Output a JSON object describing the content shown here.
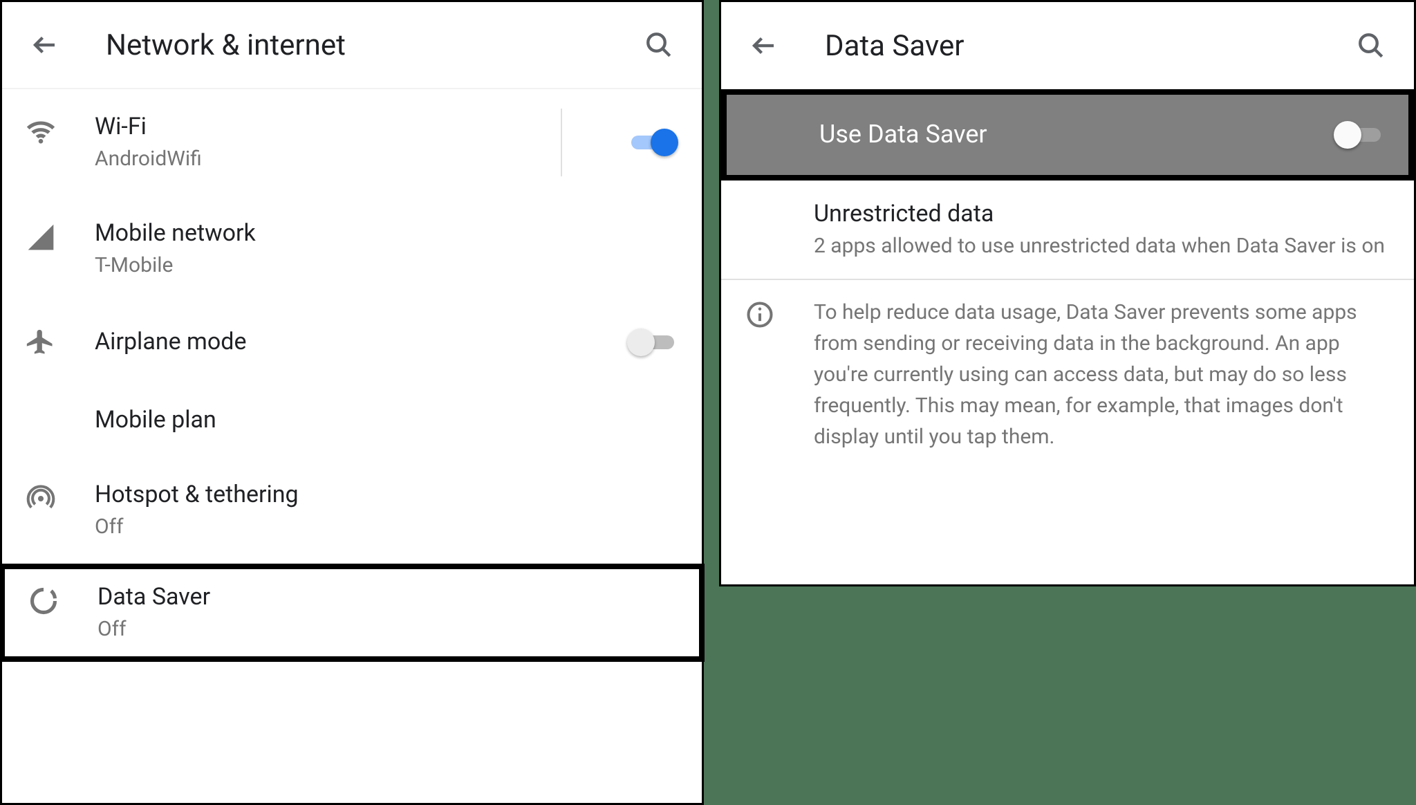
{
  "left": {
    "title": "Network & internet",
    "items": [
      {
        "title": "Wi-Fi",
        "sub": "AndroidWifi",
        "toggle": "on"
      },
      {
        "title": "Mobile network",
        "sub": "T-Mobile"
      },
      {
        "title": "Airplane mode",
        "sub": null,
        "toggle": "off"
      },
      {
        "title": "Mobile plan",
        "sub": null
      },
      {
        "title": "Hotspot & tethering",
        "sub": "Off"
      },
      {
        "title": "Data Saver",
        "sub": "Off"
      }
    ]
  },
  "right": {
    "title": "Data Saver",
    "use_row_title": "Use Data Saver",
    "unrestricted_title": "Unrestricted data",
    "unrestricted_sub": "2 apps allowed to use unrestricted data when Data Saver is on",
    "info_text": "To help reduce data usage, Data Saver prevents some apps from sending or receiving data in the background. An app you're currently using can access data, but may do so less frequently. This may mean, for example, that images don't display until you tap them."
  }
}
